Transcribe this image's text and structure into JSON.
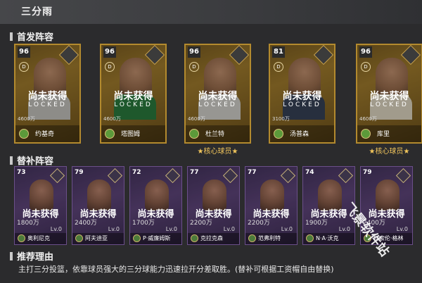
{
  "header": {
    "title": "三分雨"
  },
  "starting": {
    "section_title": "首发阵容",
    "locked_text": "尚未获得",
    "locked_en": "LOCKED",
    "cards": [
      {
        "rating": "96",
        "tier": "D",
        "price": "4600万",
        "name": "约基奇",
        "core": "",
        "jersey": "#c9c9c9"
      },
      {
        "rating": "96",
        "tier": "D",
        "price": "4600万",
        "name": "塔图姆",
        "core": "",
        "jersey": "#1f7a3d"
      },
      {
        "rating": "96",
        "tier": "D",
        "price": "4600万",
        "name": "杜兰特",
        "core": "★核心球员★",
        "jersey": "#d9d9d9"
      },
      {
        "rating": "81",
        "tier": "D",
        "price": "3100万",
        "name": "汤普森",
        "core": "",
        "jersey": "#2d3b58"
      },
      {
        "rating": "96",
        "tier": "D",
        "price": "4600万",
        "name": "库里",
        "core": "★核心球员★",
        "jersey": "#e8e1cf"
      }
    ]
  },
  "bench": {
    "section_title": "替补阵容",
    "locked_text": "尚未获得",
    "cards": [
      {
        "rating": "73",
        "price": "1800万",
        "lv": "Lv.0",
        "name": "奥利尼克"
      },
      {
        "rating": "79",
        "price": "2400万",
        "lv": "Lv.0",
        "name": "阿夫迪亚"
      },
      {
        "rating": "72",
        "price": "1700万",
        "lv": "Lv.0",
        "name": "P·威廉姆斯"
      },
      {
        "rating": "77",
        "price": "2200万",
        "lv": "Lv.0",
        "name": "克拉克森"
      },
      {
        "rating": "77",
        "price": "2200万",
        "lv": "Lv.0",
        "name": "范弗利特"
      },
      {
        "rating": "74",
        "price": "1900万",
        "lv": "Lv.0",
        "name": "N·A·沃克"
      },
      {
        "rating": "79",
        "price": "2400万",
        "lv": "Lv.0",
        "name": "科索伦·格林"
      }
    ]
  },
  "recommend": {
    "section_title": "推荐理由",
    "text": "主打三分投篮，依靠球员强大的三分球能力迅速拉开分差取胜。(替补可根据工资帽自由替换)"
  },
  "watermark": "飞景软件站",
  "colors": {
    "gold_border": "#b38a2e",
    "purple_border": "#6b4f8a",
    "core_text": "#f2c65c"
  }
}
